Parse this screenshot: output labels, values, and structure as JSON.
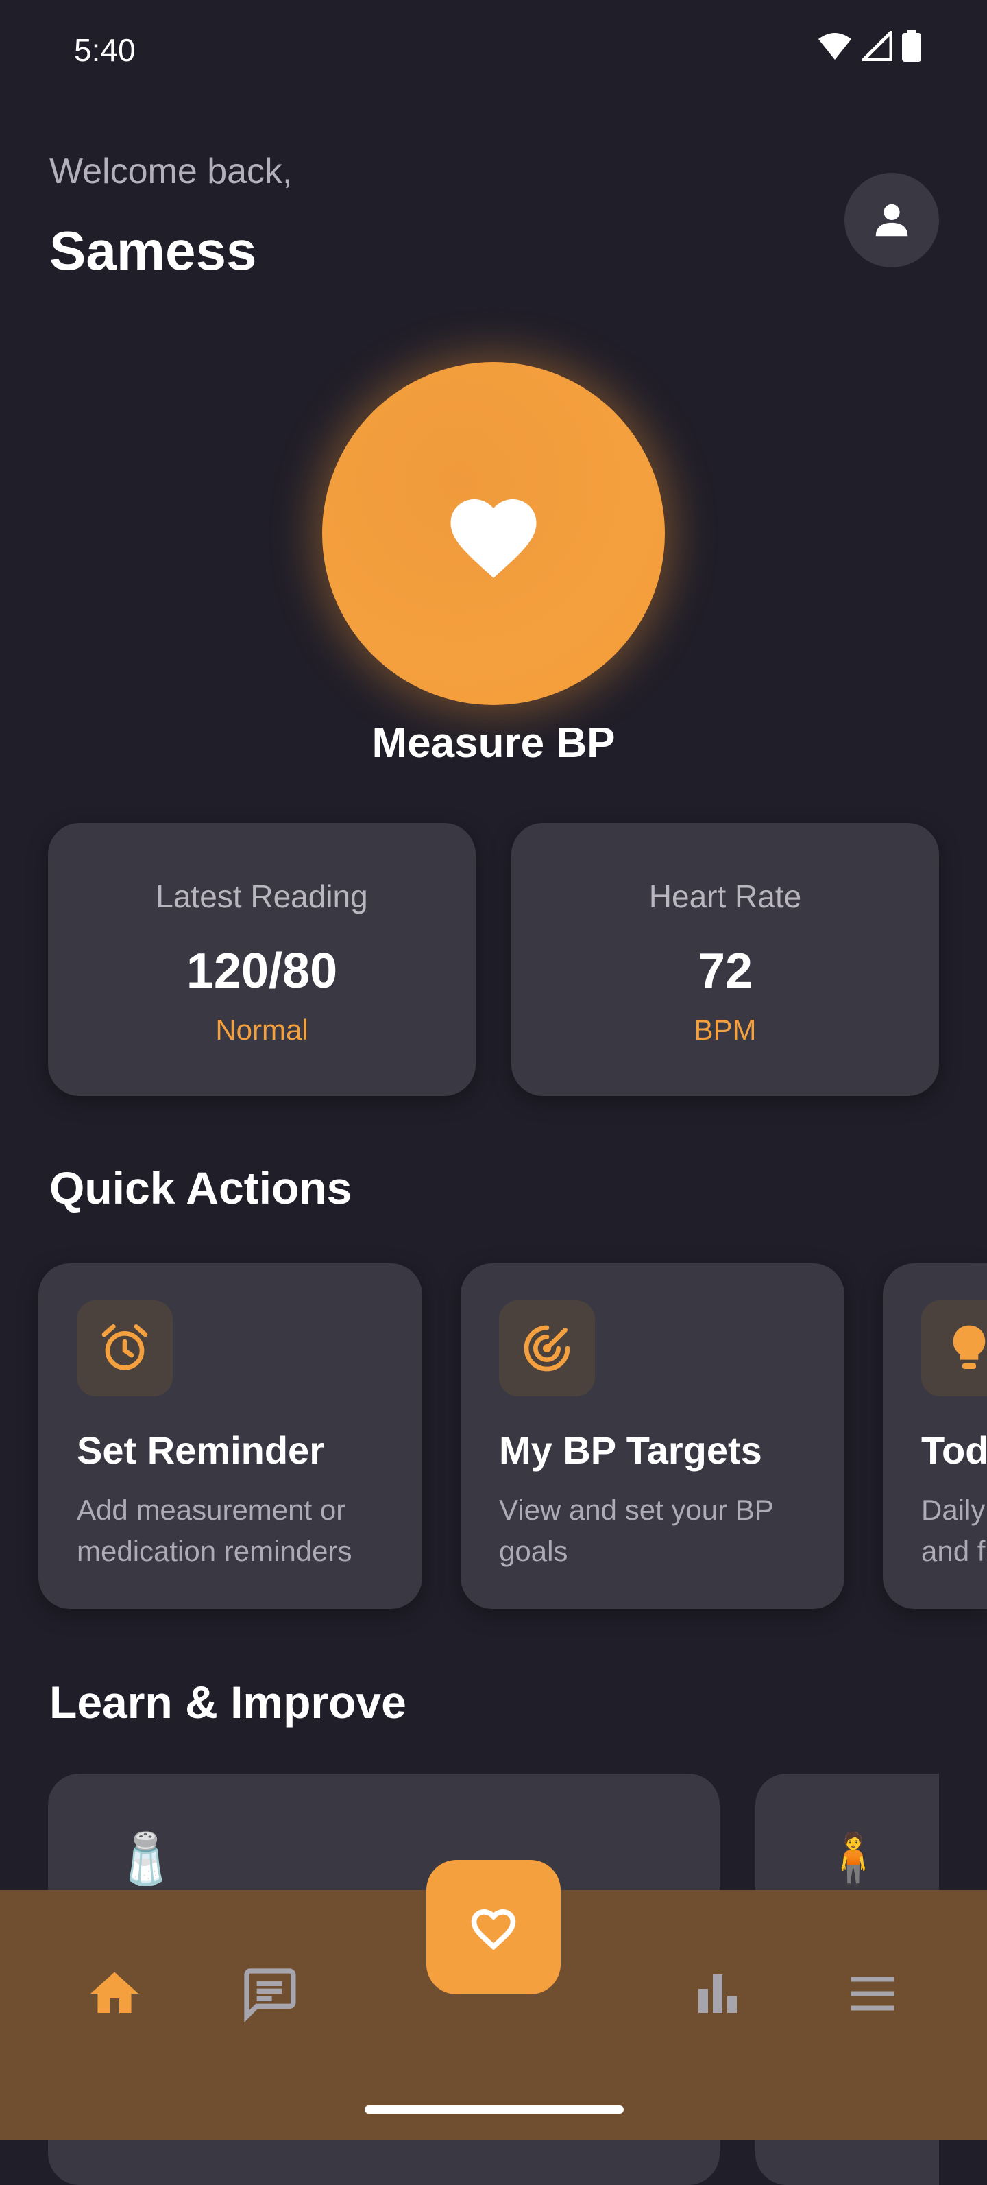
{
  "status_bar": {
    "time": "5:40"
  },
  "header": {
    "welcome": "Welcome back,",
    "username": "Samess"
  },
  "measure": {
    "label": "Measure BP"
  },
  "stats": [
    {
      "title": "Latest Reading",
      "value": "120/80",
      "sub": "Normal"
    },
    {
      "title": "Heart Rate",
      "value": "72",
      "sub": "BPM"
    }
  ],
  "quick_actions": {
    "title": "Quick Actions",
    "items": [
      {
        "title": "Set Reminder",
        "desc": "Add measurement or medication reminders",
        "icon": "alarm-icon"
      },
      {
        "title": "My BP Targets",
        "desc": "View and set your BP goals",
        "icon": "target-icon"
      },
      {
        "title": "Tod",
        "desc": "Daily and f",
        "icon": "lightbulb-icon"
      }
    ]
  },
  "learn": {
    "title": "Learn & Improve",
    "items": [
      {
        "emoji": "🧂"
      },
      {
        "emoji": "🧍"
      }
    ]
  },
  "colors": {
    "background": "#201e29",
    "card": "#393843",
    "accent": "#f5a03e",
    "nav_background": "#6f4f2f",
    "muted_icon": "#a6a4ad"
  }
}
